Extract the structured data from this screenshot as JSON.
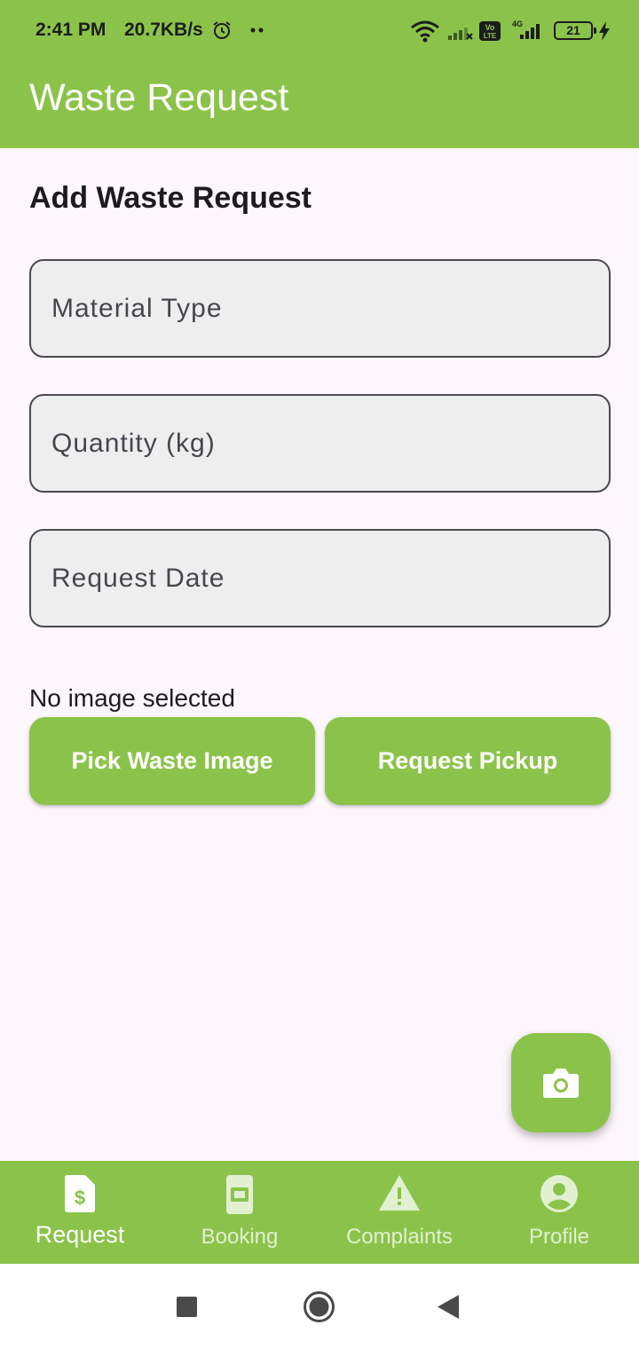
{
  "status_bar": {
    "time": "2:41 PM",
    "speed": "20.7KB/s",
    "battery": "21",
    "icons": [
      "alarm-icon",
      "wifi-icon",
      "signal-icon",
      "volte-icon",
      "4g-signal-icon",
      "battery-icon",
      "charging-icon"
    ]
  },
  "app_bar": {
    "title": "Waste Request"
  },
  "form": {
    "title": "Add Waste Request",
    "material_type": {
      "placeholder": "Material Type",
      "value": ""
    },
    "quantity": {
      "placeholder": "Quantity (kg)",
      "value": ""
    },
    "request_date": {
      "placeholder": "Request Date",
      "value": ""
    },
    "image_status": "No image selected",
    "pick_image_label": "Pick Waste Image",
    "request_pickup_label": "Request Pickup"
  },
  "fab": {
    "icon": "camera-icon"
  },
  "bottom_nav": {
    "items": [
      {
        "label": "Request",
        "icon": "request-icon",
        "active": true
      },
      {
        "label": "Booking",
        "icon": "booking-icon",
        "active": false
      },
      {
        "label": "Complaints",
        "icon": "complaints-icon",
        "active": false
      },
      {
        "label": "Profile",
        "icon": "profile-icon",
        "active": false
      }
    ]
  },
  "system_nav": {
    "icons": [
      "recents-icon",
      "home-icon",
      "back-icon"
    ]
  },
  "colors": {
    "primary": "#8bc34a",
    "background": "#fdf7fd",
    "field": "#eeeeee",
    "text": "#1d1b20"
  }
}
